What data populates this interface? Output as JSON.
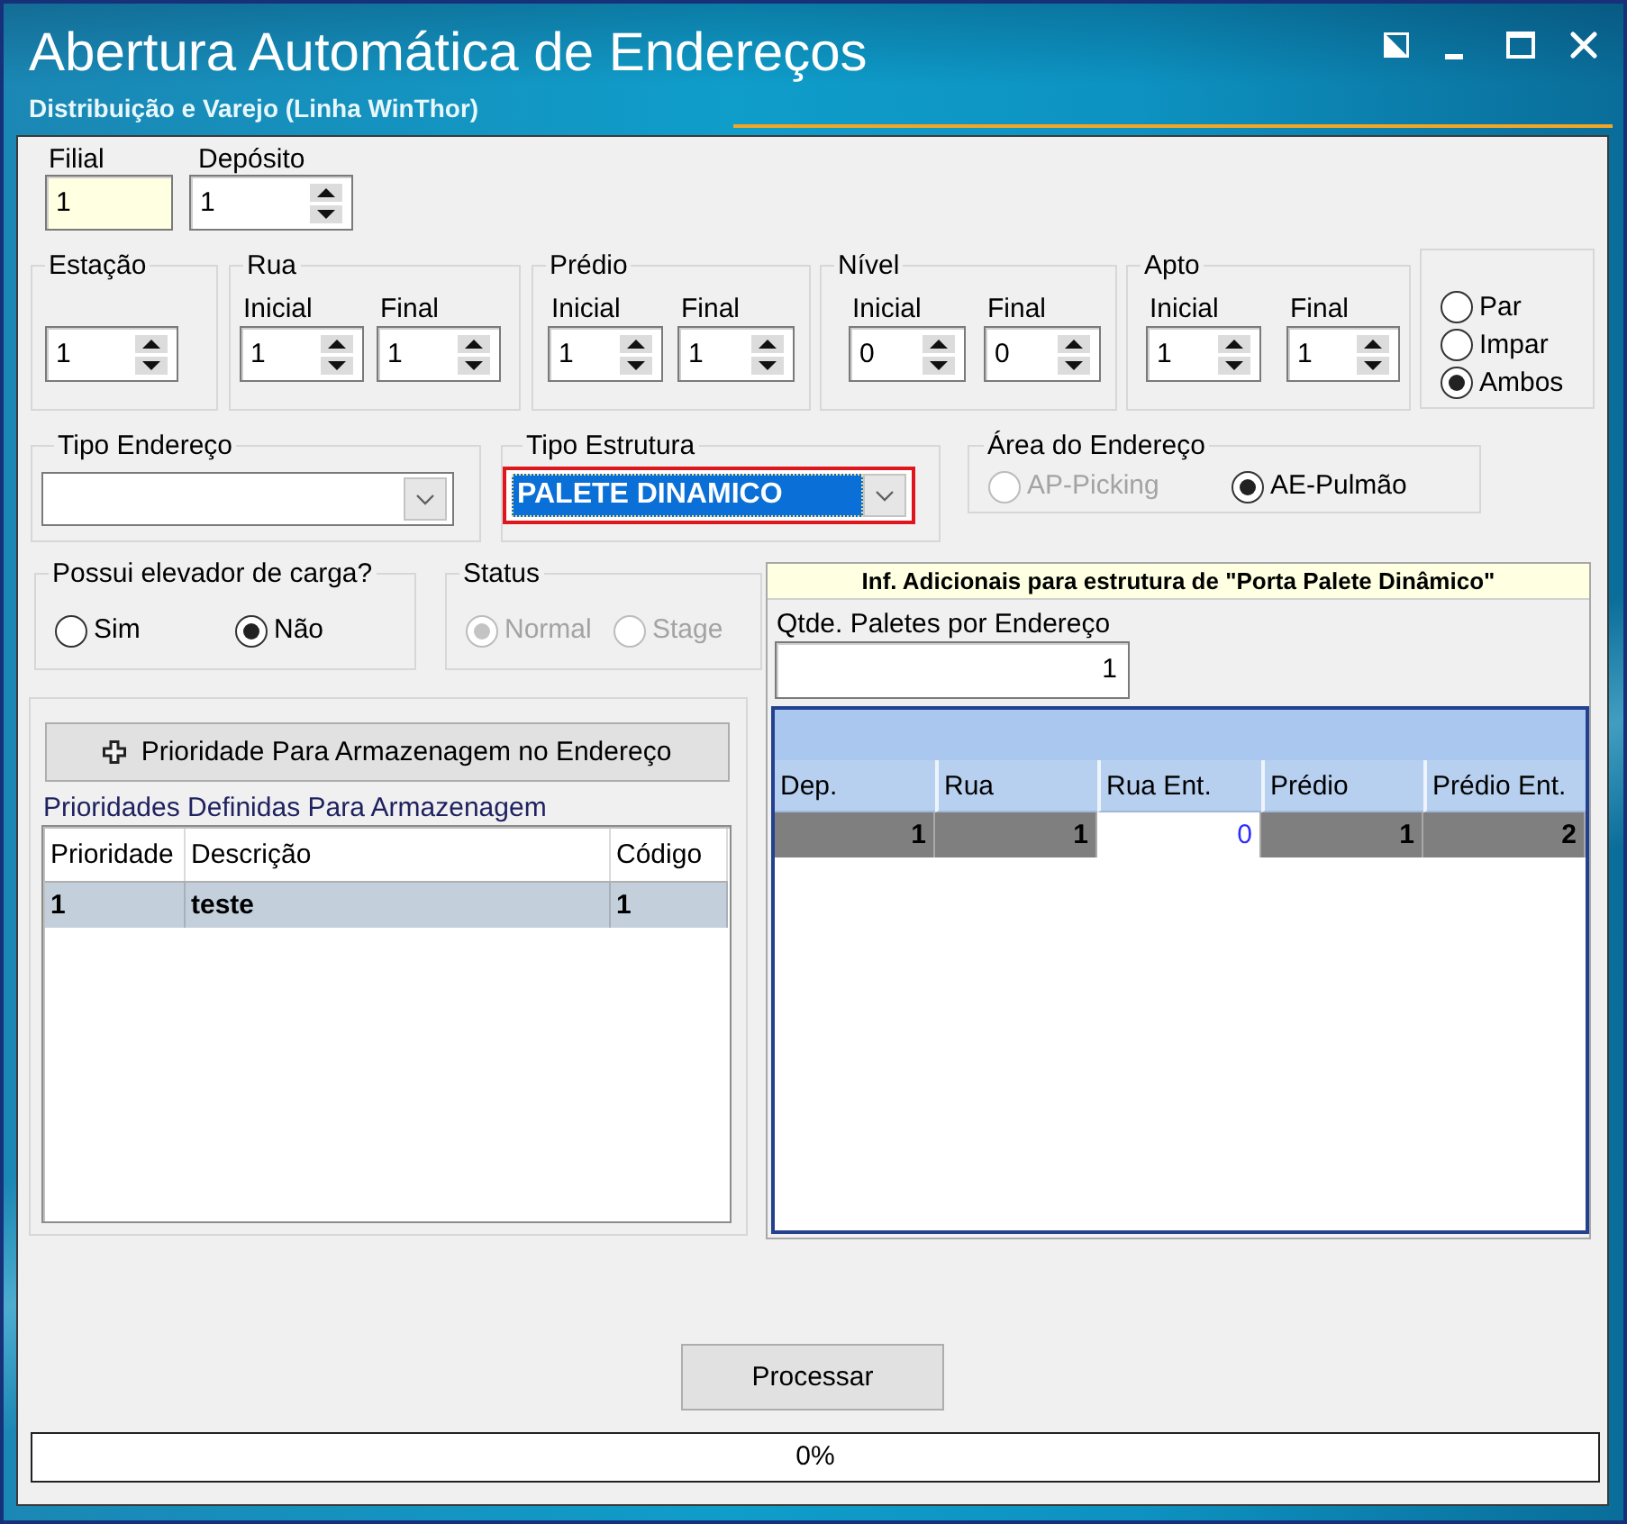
{
  "window": {
    "title": "Abertura Automática de Endereços",
    "subtitle": "Distribuição e Varejo (Linha WinThor)"
  },
  "filial": {
    "label": "Filial",
    "value": "1"
  },
  "deposito": {
    "label": "Depósito",
    "value": "1"
  },
  "ranges": [
    {
      "label": "Estação",
      "fields": [
        {
          "value": "1"
        }
      ]
    },
    {
      "label": "Rua",
      "fields": [
        {
          "label": "Inicial",
          "value": "1"
        },
        {
          "label": "Final",
          "value": "1"
        }
      ]
    },
    {
      "label": "Prédio",
      "fields": [
        {
          "label": "Inicial",
          "value": "1"
        },
        {
          "label": "Final",
          "value": "1"
        }
      ]
    },
    {
      "label": "Nível",
      "fields": [
        {
          "label": "Inicial",
          "value": "0"
        },
        {
          "label": "Final",
          "value": "0"
        }
      ]
    },
    {
      "label": "Apto",
      "fields": [
        {
          "label": "Inicial",
          "value": "1"
        },
        {
          "label": "Final",
          "value": "1"
        }
      ]
    }
  ],
  "parity": [
    {
      "label": "Par",
      "selected": false
    },
    {
      "label": "Impar",
      "selected": false
    },
    {
      "label": "Ambos",
      "selected": true
    }
  ],
  "tipo_endereco": {
    "label": "Tipo Endereço"
  },
  "tipo_estrutura": {
    "label": "Tipo Estrutura",
    "value": "PALETE DINAMICO",
    "focused": true,
    "highlighted": true
  },
  "area_endereco": {
    "label": "Área do Endereço",
    "options": [
      {
        "label": "AP-Picking",
        "selected": false,
        "disabled": true
      },
      {
        "label": "AE-Pulmão",
        "selected": true,
        "disabled": false
      }
    ]
  },
  "elevador": {
    "label": "Possui elevador de carga?",
    "options": [
      {
        "label": "Sim",
        "selected": false
      },
      {
        "label": "Não",
        "selected": true
      }
    ]
  },
  "status": {
    "label": "Status",
    "options": [
      {
        "label": "Normal",
        "selected": true,
        "disabled": true
      },
      {
        "label": "Stage",
        "selected": false,
        "disabled": true
      }
    ]
  },
  "prioridades": {
    "button": "Prioridade Para Armazenagem no Endereço",
    "caption": "Prioridades Definidas Para Armazenagem",
    "columns": [
      "Prioridade",
      "Descrição",
      "Código"
    ],
    "rows": [
      {
        "cells": [
          "1",
          "teste",
          "1"
        ],
        "selected": true
      }
    ]
  },
  "info_adicional": {
    "title": "Inf. Adicionais para estrutura de \"Porta Palete Dinâmico\"",
    "qtde_label": "Qtde. Paletes por Endereço",
    "qtde_value": "1",
    "columns": [
      "Dep.",
      "Rua",
      "Rua Ent.",
      "Prédio",
      "Prédio Ent."
    ],
    "rows": [
      {
        "selected": true,
        "cells": [
          {
            "value": "1",
            "editing": false
          },
          {
            "value": "1",
            "editing": false
          },
          {
            "value": "0",
            "editing": true
          },
          {
            "value": "1",
            "editing": false
          },
          {
            "value": "2",
            "editing": false
          }
        ]
      }
    ]
  },
  "process_button": "Processar",
  "progress": {
    "level": 0,
    "reading": "0%"
  }
}
